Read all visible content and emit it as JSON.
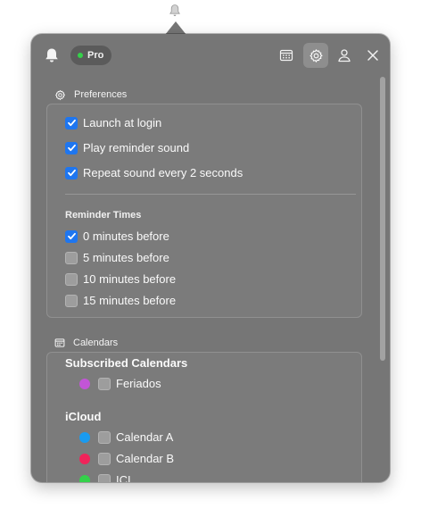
{
  "menubar": {
    "icon": "bell-icon"
  },
  "header": {
    "app_icon": "bell-icon",
    "badge_label": "Pro",
    "badge_dot_color": "#35d14a",
    "buttons": [
      "calendar-icon",
      "gear-icon",
      "person-icon",
      "close-icon"
    ],
    "active_button": "gear-icon"
  },
  "preferences": {
    "title": "Preferences",
    "options": [
      {
        "label": "Launch at login",
        "checked": true
      },
      {
        "label": "Play reminder sound",
        "checked": true
      },
      {
        "label": "Repeat sound every 2 seconds",
        "checked": true
      }
    ],
    "reminder_times_heading": "Reminder Times",
    "reminder_times": [
      {
        "label": "0 minutes before",
        "checked": true
      },
      {
        "label": "5 minutes before",
        "checked": false
      },
      {
        "label": "10 minutes before",
        "checked": false
      },
      {
        "label": "15 minutes before",
        "checked": false
      }
    ]
  },
  "calendars": {
    "title": "Calendars",
    "groups": [
      {
        "name": "Subscribed Calendars",
        "items": [
          {
            "label": "Feriados",
            "color": "#c255d6",
            "checked": false
          }
        ]
      },
      {
        "name": "iCloud",
        "items": [
          {
            "label": "Calendar A",
            "color": "#1a9bf0",
            "checked": false
          },
          {
            "label": "Calendar B",
            "color": "#f0245a",
            "checked": false
          },
          {
            "label": "ICI",
            "color": "#34d14a",
            "checked": false
          }
        ]
      }
    ]
  },
  "colors": {
    "accent": "#1e76f0",
    "panel": "#767676"
  }
}
